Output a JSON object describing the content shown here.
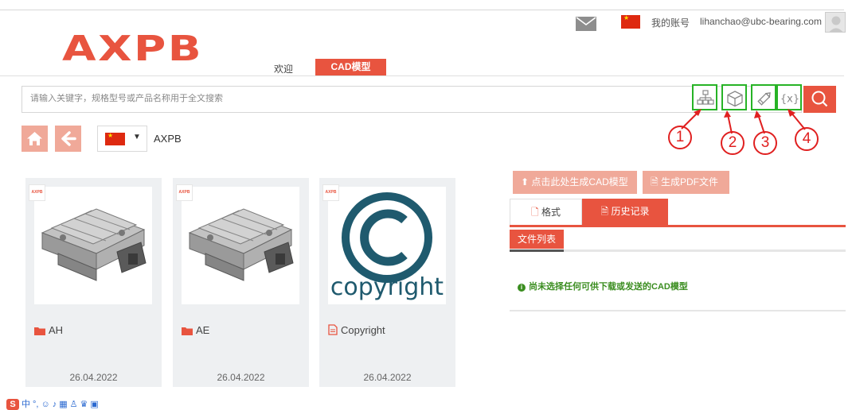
{
  "header": {
    "logo_text": "AXPB",
    "account_label": "我的账号",
    "email": "lihanchao@ubc-bearing.com",
    "nav": {
      "welcome": "欢迎",
      "cad": "CAD模型"
    }
  },
  "search": {
    "placeholder": "请输入关键字，规格型号或产品名称用于全文搜索"
  },
  "annotations": [
    "1",
    "2",
    "3",
    "4"
  ],
  "breadcrumb": {
    "brand": "AXPB"
  },
  "cards": [
    {
      "badge": "AXPB",
      "name": "AH",
      "date": "26.04.2022",
      "type": "folder"
    },
    {
      "badge": "AXPB",
      "name": "AE",
      "date": "26.04.2022",
      "type": "folder"
    },
    {
      "badge": "AXPB",
      "name": "Copyright",
      "date": "26.04.2022",
      "type": "file",
      "thumb_text": "copyright"
    }
  ],
  "panel": {
    "generate_cad": "点击此处生成CAD模型",
    "generate_pdf": "生成PDF文件",
    "tabs": {
      "format": "格式",
      "history": "历史记录"
    },
    "file_list": "文件列表",
    "notice": "尚未选择任何可供下载或发送的CAD模型"
  },
  "ime": {
    "logo": "S",
    "mode": "中"
  },
  "colors": {
    "accent": "#e8543f",
    "accent_light": "#f0a999",
    "highlight": "#27b326",
    "annotation": "#e02020",
    "notice": "#3a8d1f"
  }
}
